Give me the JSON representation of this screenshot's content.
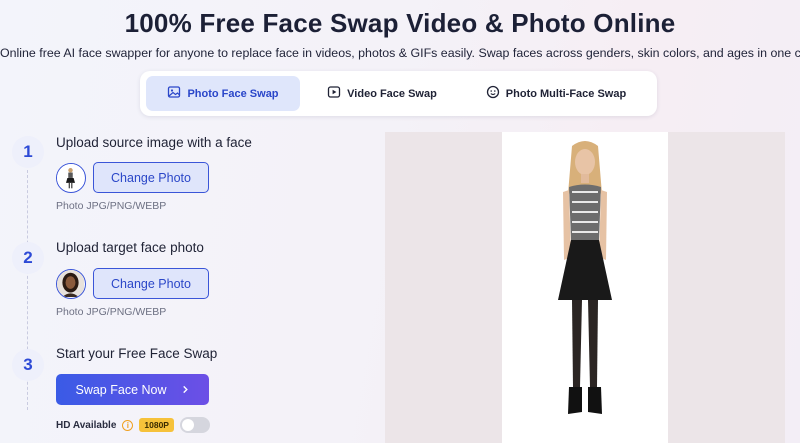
{
  "header": {
    "title": "100% Free Face Swap Video & Photo Online",
    "subtitle": "Online free AI face swapper for anyone to replace face in videos, photos & GIFs easily. Swap faces across genders, skin colors, and ages in one click!"
  },
  "tabs": [
    {
      "label": "Photo Face Swap",
      "icon": "image-icon",
      "active": true
    },
    {
      "label": "Video Face Swap",
      "icon": "video-play-icon",
      "active": false
    },
    {
      "label": "Photo Multi-Face Swap",
      "icon": "multi-face-icon",
      "active": false
    }
  ],
  "steps": [
    {
      "number": "1",
      "title": "Upload source image with a face",
      "button": "Change Photo",
      "hint": "Photo JPG/PNG/WEBP"
    },
    {
      "number": "2",
      "title": "Upload target face photo",
      "button": "Change Photo",
      "hint": "Photo JPG/PNG/WEBP"
    },
    {
      "number": "3",
      "title": "Start your Free Face Swap",
      "button": "Swap Face Now",
      "button_icon": "chevron-right-icon"
    }
  ],
  "hd": {
    "label": "HD Available",
    "info_icon": "i",
    "badge": "1080P",
    "enabled": false
  },
  "colors": {
    "accent": "#2a46c9",
    "tab_active_bg": "#dfe6fb",
    "badge": "#f6c23a",
    "swap_gradient_start": "#3a5be6",
    "swap_gradient_end": "#6c4fe6"
  }
}
